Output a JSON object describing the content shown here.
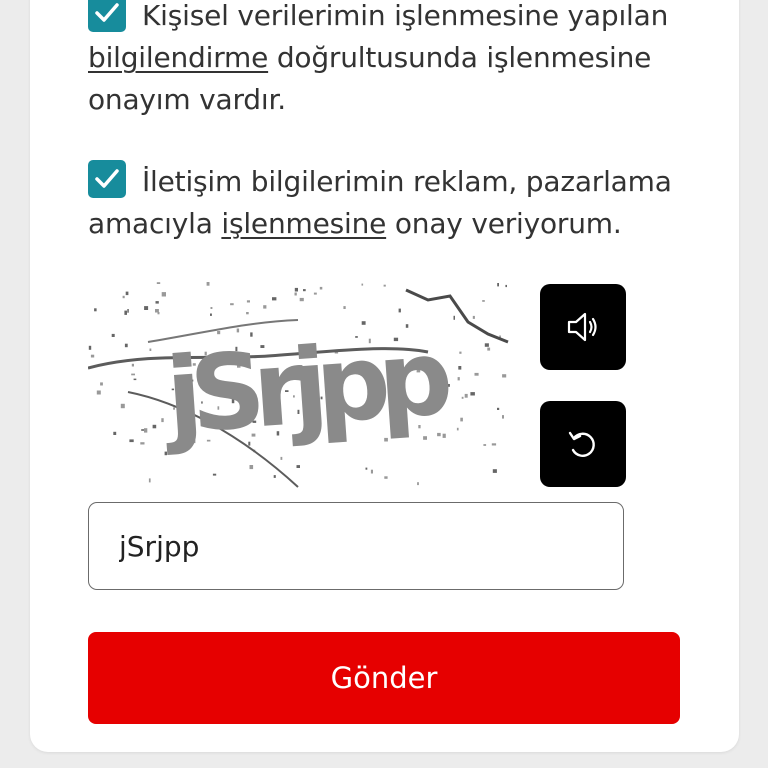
{
  "consents": [
    {
      "checked": true,
      "before": "Kişisel verilerimin işlenmesine yapılan ",
      "link": "bilgilendirme",
      "after": " doğrultusunda işlenmesine onayım vardır."
    },
    {
      "checked": true,
      "before": "İletişim bilgilerimin reklam, pazarlama amacıyla ",
      "link": "işlenmesine",
      "after": " onay veriyorum."
    }
  ],
  "captcha": {
    "text": "jSrjpp",
    "audio_icon": "speaker-icon",
    "refresh_icon": "refresh-icon"
  },
  "input": {
    "value": "jSrjpp"
  },
  "submit": {
    "label": "Gönder"
  },
  "colors": {
    "checkbox": "#178c9c",
    "submit": "#e60000",
    "captcha_text": "#8a8a8a"
  }
}
